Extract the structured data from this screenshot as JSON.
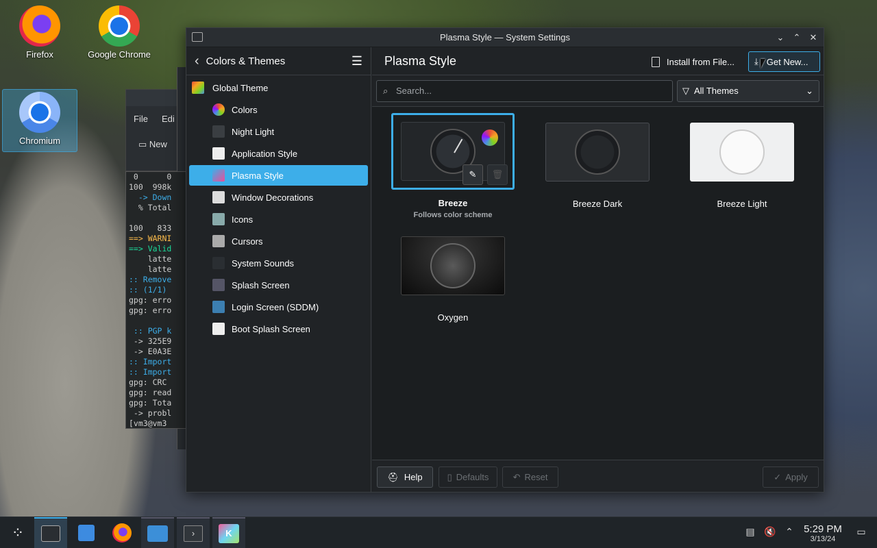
{
  "desktop": {
    "icons": [
      {
        "label": "Firefox"
      },
      {
        "label": "Google Chrome"
      },
      {
        "label": "Chromium"
      }
    ]
  },
  "bg_editor": {
    "menu_file": "File",
    "menu_edit": "Edi",
    "new_btn": "New"
  },
  "terminal": {
    "lines": [
      " 0      0",
      "100  998k",
      "  -> Down",
      "  % Total",
      "",
      "100   833",
      "==> WARNI",
      "==> Valid",
      "    latte",
      "    latte",
      ":: Remove",
      ":: (1/1)",
      "gpg: erro",
      "gpg: erro",
      "",
      " :: PGP k",
      " -> 325E9",
      " -> E0A3E",
      ":: Import",
      ":: Import",
      "gpg: CRC",
      "gpg: read",
      "gpg: Tota",
      " -> probl",
      "[vm3@vm3"
    ]
  },
  "window": {
    "title": "Plasma Style — System Settings",
    "sidebar": {
      "back_label": "Colors & Themes",
      "items": [
        {
          "label": "Global Theme",
          "icon": "global-theme-icon"
        },
        {
          "label": "Colors",
          "icon": "colors-icon"
        },
        {
          "label": "Night Light",
          "icon": "night-light-icon"
        },
        {
          "label": "Application Style",
          "icon": "application-style-icon"
        },
        {
          "label": "Plasma Style",
          "icon": "plasma-style-icon",
          "active": true
        },
        {
          "label": "Window Decorations",
          "icon": "window-decorations-icon"
        },
        {
          "label": "Icons",
          "icon": "icons-icon"
        },
        {
          "label": "Cursors",
          "icon": "cursors-icon"
        },
        {
          "label": "System Sounds",
          "icon": "system-sounds-icon"
        },
        {
          "label": "Splash Screen",
          "icon": "splash-screen-icon"
        },
        {
          "label": "Login Screen (SDDM)",
          "icon": "login-screen-icon"
        },
        {
          "label": "Boot Splash Screen",
          "icon": "boot-splash-icon"
        }
      ]
    },
    "page_title": "Plasma Style",
    "install_label": "Install from File...",
    "get_new_label": "Get New...",
    "search_placeholder": "Search...",
    "filter_selected": "All Themes",
    "themes": [
      {
        "name": "Breeze",
        "subtitle": "Follows color scheme",
        "selected": true
      },
      {
        "name": "Breeze Dark"
      },
      {
        "name": "Breeze Light"
      },
      {
        "name": "Oxygen"
      }
    ],
    "footer": {
      "help": "Help",
      "defaults": "Defaults",
      "reset": "Reset",
      "apply": "Apply"
    }
  },
  "taskbar": {
    "time": "5:29 PM",
    "date": "3/13/24"
  },
  "colors": {
    "accent": "#3daee9",
    "window_bg": "#202326",
    "content_bg": "#1b1e20"
  }
}
